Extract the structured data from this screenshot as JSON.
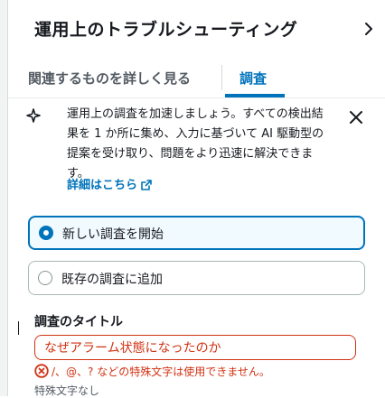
{
  "header": {
    "title": "運用上のトラブルシューティング"
  },
  "tabs": [
    {
      "label": "関連するものを詳しく見る",
      "active": false
    },
    {
      "label": "調査",
      "active": true
    }
  ],
  "info": {
    "text": "運用上の調査を加速しましょう。すべての検出結果を 1 か所に集め、入力に基づいて AI 駆動型の提案を受け取り、問題をより迅速に解決できます。",
    "link_label": "詳細はこちら"
  },
  "options": [
    {
      "label": "新しい調査を開始",
      "selected": true
    },
    {
      "label": "既存の調査に追加",
      "selected": false
    }
  ],
  "form": {
    "title_label": "調査のタイトル",
    "title_value": "なぜアラーム状態になったのか",
    "error": "/、@、? などの特殊文字は使用できません。",
    "hint": "特殊文字なし"
  },
  "colors": {
    "accent": "#0073bb",
    "error": "#d13212",
    "text": "#16191f",
    "muted": "#545b64"
  },
  "icons": {
    "sparkle": "sparkle-icon",
    "close": "close-icon",
    "chevron": "chevron-right-icon",
    "external": "external-link-icon",
    "error": "error-icon"
  }
}
